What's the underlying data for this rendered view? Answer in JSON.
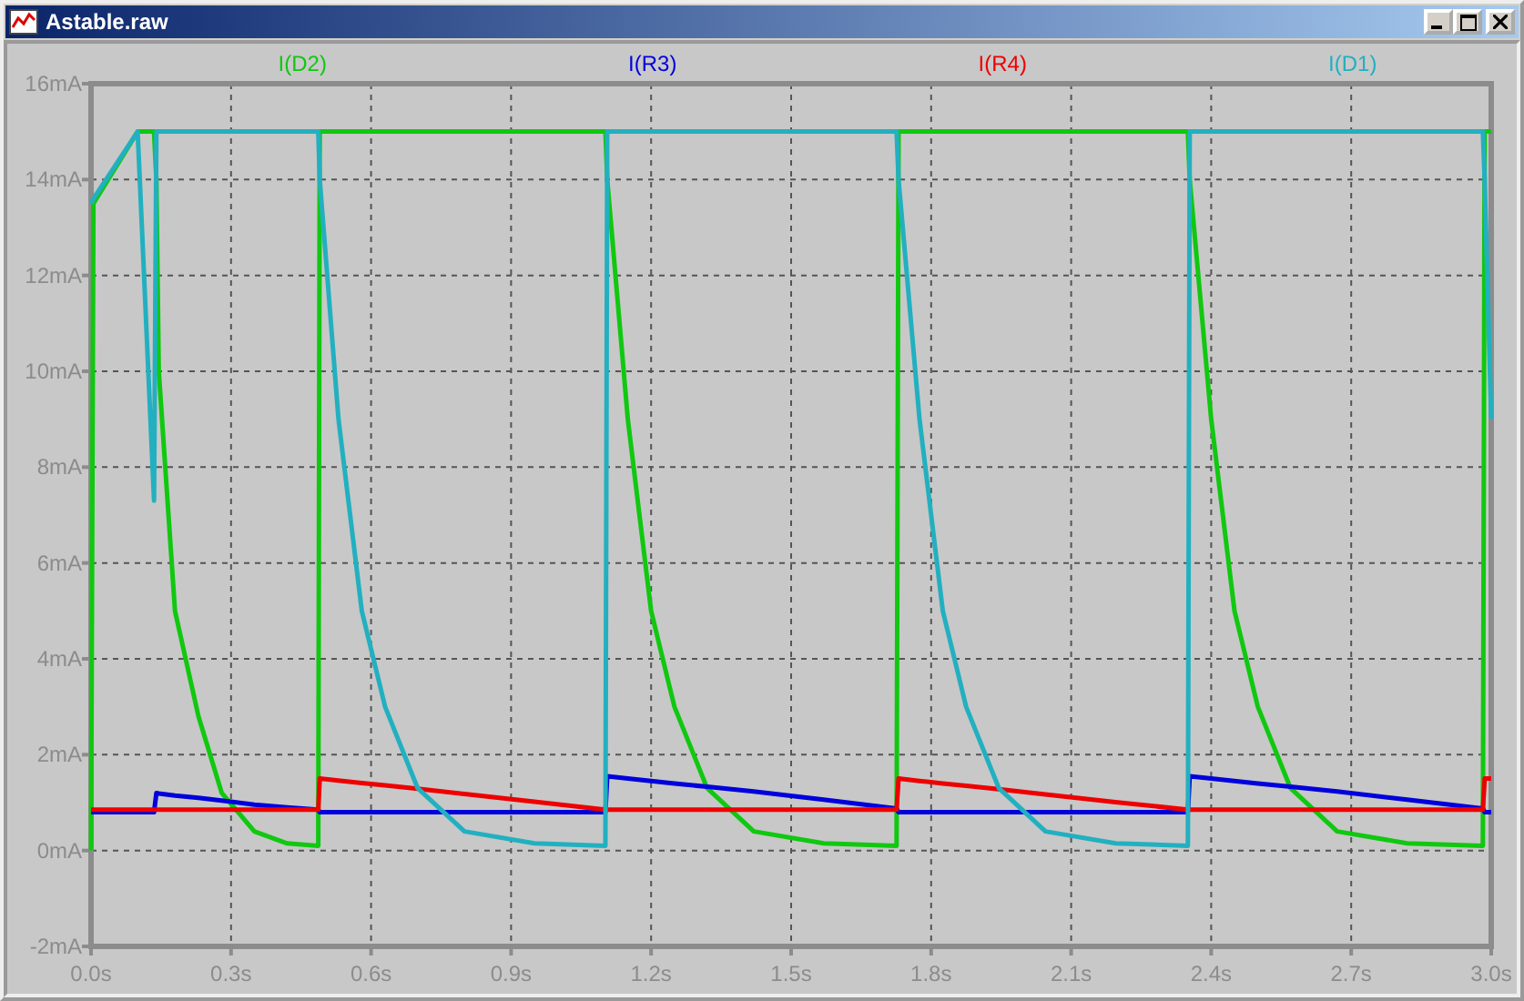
{
  "window": {
    "title": "Astable.raw"
  },
  "plot": {
    "chart_data": {
      "type": "line",
      "x": [
        0,
        0.005,
        0.1,
        0.135,
        0.14,
        0.145,
        0.18,
        0.23,
        0.28,
        0.35,
        0.42,
        0.487,
        0.49,
        0.53,
        0.58,
        0.63,
        0.7,
        0.8,
        0.95,
        1.102,
        1.106,
        1.15,
        1.2,
        1.25,
        1.32,
        1.42,
        1.57,
        1.726,
        1.73,
        1.775,
        1.825,
        1.875,
        1.945,
        2.045,
        2.195,
        2.35,
        2.354,
        2.4,
        2.45,
        2.5,
        2.57,
        2.67,
        2.82,
        2.982,
        2.986,
        3.0
      ],
      "series": [
        {
          "name": "I(D2)",
          "color": "#10c810",
          "values": [
            0,
            13.5,
            15,
            15,
            14,
            10,
            5,
            2.8,
            1.2,
            0.4,
            0.15,
            0.1,
            15,
            15,
            15,
            15,
            15,
            15,
            15,
            15,
            14,
            9,
            5,
            3,
            1.3,
            0.4,
            0.15,
            0.1,
            15,
            15,
            15,
            15,
            15,
            15,
            15,
            15,
            14,
            9,
            5,
            3,
            1.3,
            0.4,
            0.15,
            0.1,
            15,
            15
          ]
        },
        {
          "name": "I(R3)",
          "color": "#0000dd",
          "values": [
            0.8,
            0.8,
            0.8,
            0.8,
            1.2,
            1.19,
            1.15,
            1.1,
            1.04,
            0.96,
            0.9,
            0.85,
            0.8,
            0.8,
            0.8,
            0.8,
            0.8,
            0.8,
            0.8,
            0.8,
            1.55,
            1.5,
            1.45,
            1.4,
            1.33,
            1.23,
            1.06,
            0.88,
            0.8,
            0.8,
            0.8,
            0.8,
            0.8,
            0.8,
            0.8,
            0.8,
            1.55,
            1.5,
            1.45,
            1.4,
            1.33,
            1.23,
            1.06,
            0.88,
            0.8,
            0.8
          ]
        },
        {
          "name": "I(R4)",
          "color": "#ee0000",
          "values": [
            0.85,
            0.85,
            0.85,
            0.85,
            0.85,
            0.85,
            0.85,
            0.85,
            0.85,
            0.85,
            0.85,
            0.85,
            1.5,
            1.46,
            1.41,
            1.36,
            1.29,
            1.18,
            1.02,
            0.85,
            0.85,
            0.85,
            0.85,
            0.85,
            0.85,
            0.85,
            0.85,
            0.85,
            1.5,
            1.45,
            1.4,
            1.35,
            1.28,
            1.17,
            1.01,
            0.85,
            0.85,
            0.85,
            0.85,
            0.85,
            0.85,
            0.85,
            0.85,
            0.85,
            1.5,
            1.5
          ]
        },
        {
          "name": "I(D1)",
          "color": "#22b0c0",
          "values": [
            13.5,
            13.6,
            15,
            7.3,
            15,
            15,
            15,
            15,
            15,
            15,
            15,
            15,
            14,
            9,
            5,
            3,
            1.3,
            0.4,
            0.15,
            0.1,
            15,
            15,
            15,
            15,
            15,
            15,
            15,
            15,
            14,
            9,
            5,
            3,
            1.3,
            0.4,
            0.15,
            0.1,
            15,
            15,
            15,
            15,
            15,
            15,
            15,
            15,
            14,
            9
          ]
        }
      ],
      "grid": true,
      "xlim": [
        0,
        3
      ],
      "ylim": [
        -2,
        16
      ],
      "xticks": [
        {
          "value": 0,
          "label": "0.0s"
        },
        {
          "value": 0.3,
          "label": "0.3s"
        },
        {
          "value": 0.6,
          "label": "0.6s"
        },
        {
          "value": 0.9,
          "label": "0.9s"
        },
        {
          "value": 1.2,
          "label": "1.2s"
        },
        {
          "value": 1.5,
          "label": "1.5s"
        },
        {
          "value": 1.8,
          "label": "1.8s"
        },
        {
          "value": 2.1,
          "label": "2.1s"
        },
        {
          "value": 2.4,
          "label": "2.4s"
        },
        {
          "value": 2.7,
          "label": "2.7s"
        },
        {
          "value": 3.0,
          "label": "3.0s"
        }
      ],
      "yticks": [
        {
          "value": -2,
          "label": "-2mA"
        },
        {
          "value": 0,
          "label": "0mA"
        },
        {
          "value": 2,
          "label": "2mA"
        },
        {
          "value": 4,
          "label": "4mA"
        },
        {
          "value": 6,
          "label": "6mA"
        },
        {
          "value": 8,
          "label": "8mA"
        },
        {
          "value": 10,
          "label": "10mA"
        },
        {
          "value": 12,
          "label": "12mA"
        },
        {
          "value": 14,
          "label": "14mA"
        },
        {
          "value": 16,
          "label": "16mA"
        }
      ]
    }
  }
}
